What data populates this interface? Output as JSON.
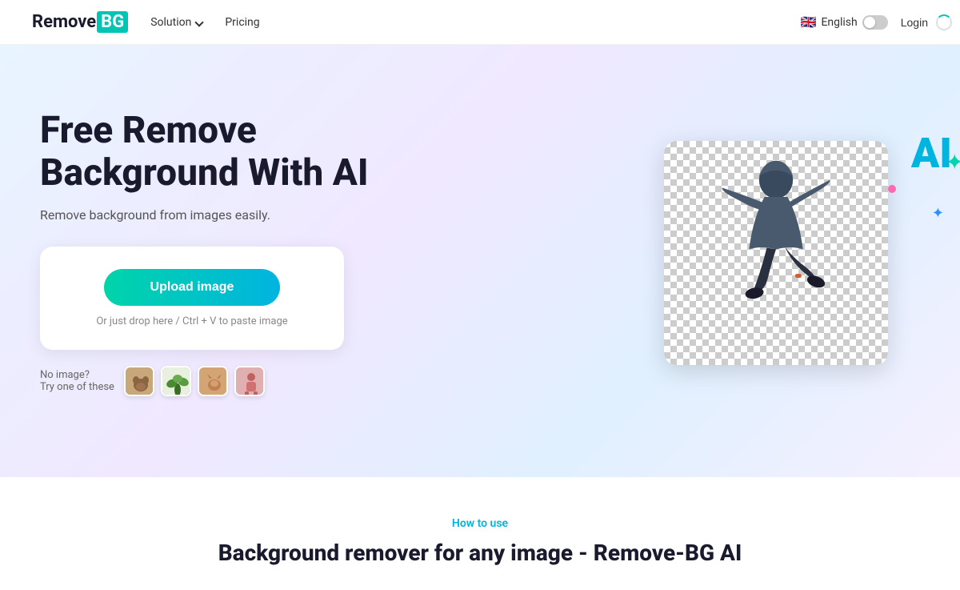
{
  "navbar": {
    "logo": {
      "remove_text": "Remove",
      "bg_text": "BG"
    },
    "solution_label": "Solution",
    "pricing_label": "Pricing",
    "language": {
      "label": "English",
      "flag": "🇬🇧"
    },
    "login_label": "Login"
  },
  "hero": {
    "title_line1": "Free Remove",
    "title_line2": "Background With AI",
    "subtitle": "Remove background from images easily.",
    "upload_button": "Upload image",
    "upload_hint": "Or just drop here / Ctrl + V to paste image",
    "no_image_label": "No image?",
    "try_label": "Try one of these",
    "ai_label": "AI"
  },
  "sample_thumbs": [
    {
      "id": "dog",
      "class": "thumb-dog"
    },
    {
      "id": "plant",
      "class": "thumb-plant"
    },
    {
      "id": "cat",
      "class": "thumb-cat"
    },
    {
      "id": "person",
      "class": "thumb-person"
    }
  ],
  "bottom": {
    "how_to_use": "How to use",
    "title": "Background remover for any image - Remove-BG AI"
  },
  "colors": {
    "accent": "#00b4e0",
    "accent2": "#00d4aa",
    "brand_blue": "#00c4b4"
  }
}
